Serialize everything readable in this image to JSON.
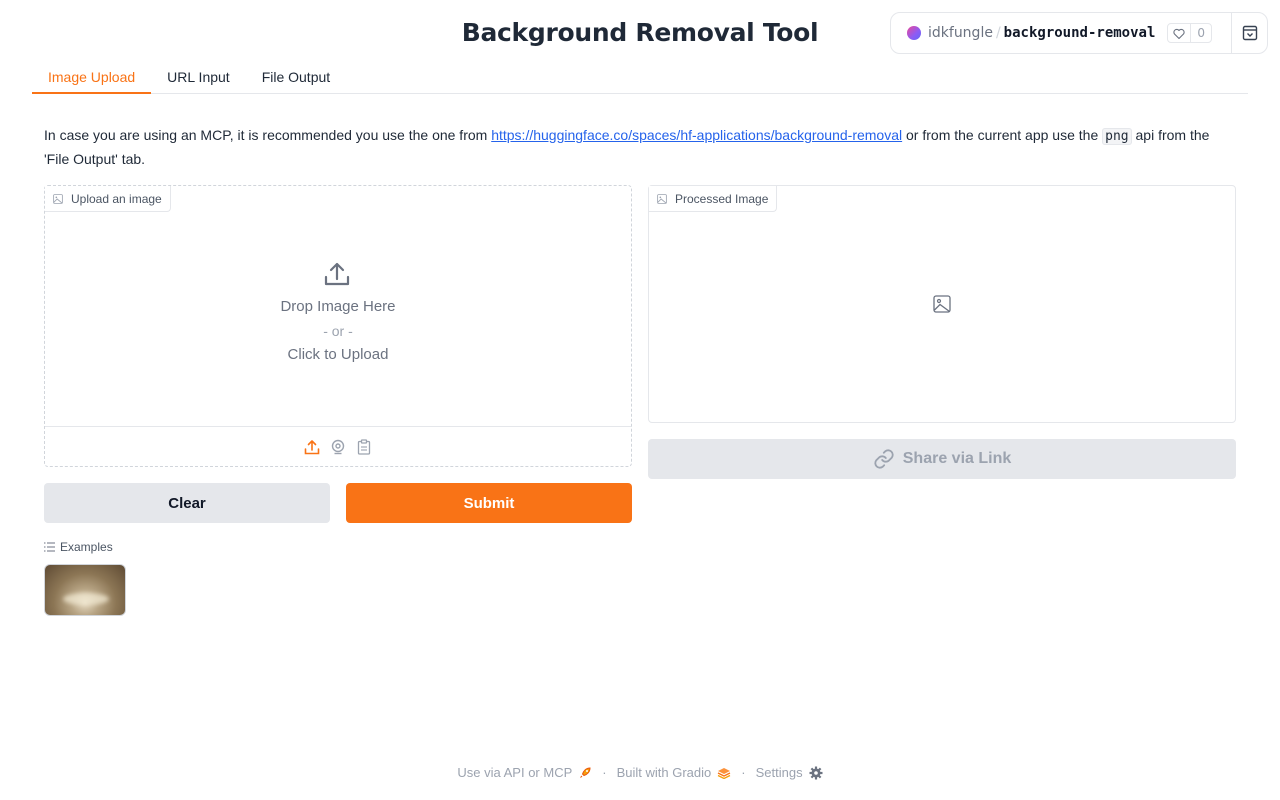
{
  "app": {
    "title": "Background Removal Tool"
  },
  "hf_badge": {
    "user": "idkfungle",
    "separator": "/",
    "space": "background-removal",
    "likes": "0",
    "heart_icon": "heart-icon",
    "collapse_icon": "collapse-icon"
  },
  "tabs": [
    {
      "label": "Image Upload",
      "active": true
    },
    {
      "label": "URL Input",
      "active": false
    },
    {
      "label": "File Output",
      "active": false
    }
  ],
  "description": {
    "before": "In case you are using an MCP, it is recommended you use the one from ",
    "link": "https://huggingface.co/spaces/hf-applications/background-removal",
    "middle": " or from the current app use the ",
    "code": "png",
    "after": " api from the 'File Output' tab."
  },
  "upload": {
    "label": "Upload an image",
    "drop_text": "Drop Image Here",
    "or_text": "- or -",
    "click_text": "Click to Upload"
  },
  "processed": {
    "label": "Processed Image"
  },
  "buttons": {
    "share": "Share via Link",
    "clear": "Clear",
    "submit": "Submit"
  },
  "examples": {
    "label": "Examples"
  },
  "footer": {
    "api": "Use via API or MCP",
    "built": "Built with Gradio",
    "settings": "Settings",
    "separator": "·"
  },
  "colors": {
    "accent": "#f97316",
    "link": "#2563eb",
    "muted": "#9ca3af"
  }
}
